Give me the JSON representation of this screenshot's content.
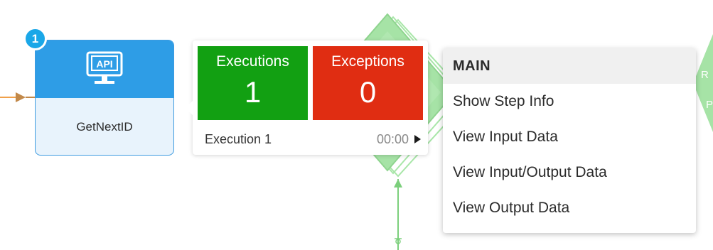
{
  "step": {
    "badge": "1",
    "icon_text": "API",
    "name": "GetNextID"
  },
  "exec_popup": {
    "executions_label": "Executions",
    "executions_count": "1",
    "exceptions_label": "Exceptions",
    "exceptions_count": "0",
    "execution_row_label": "Execution 1",
    "execution_row_time": "00:00"
  },
  "context_menu": {
    "header": "MAIN",
    "items": [
      {
        "label": "Show Step Info"
      },
      {
        "label": "View Input Data"
      },
      {
        "label": "View Input/Output Data"
      },
      {
        "label": "View Output Data"
      }
    ]
  },
  "colors": {
    "node_header": "#2e9de6",
    "executions_bg": "#12a012",
    "exceptions_bg": "#e02d12",
    "diamond_green": "#8fdc8f",
    "connector_orange": "#f0a04b"
  }
}
